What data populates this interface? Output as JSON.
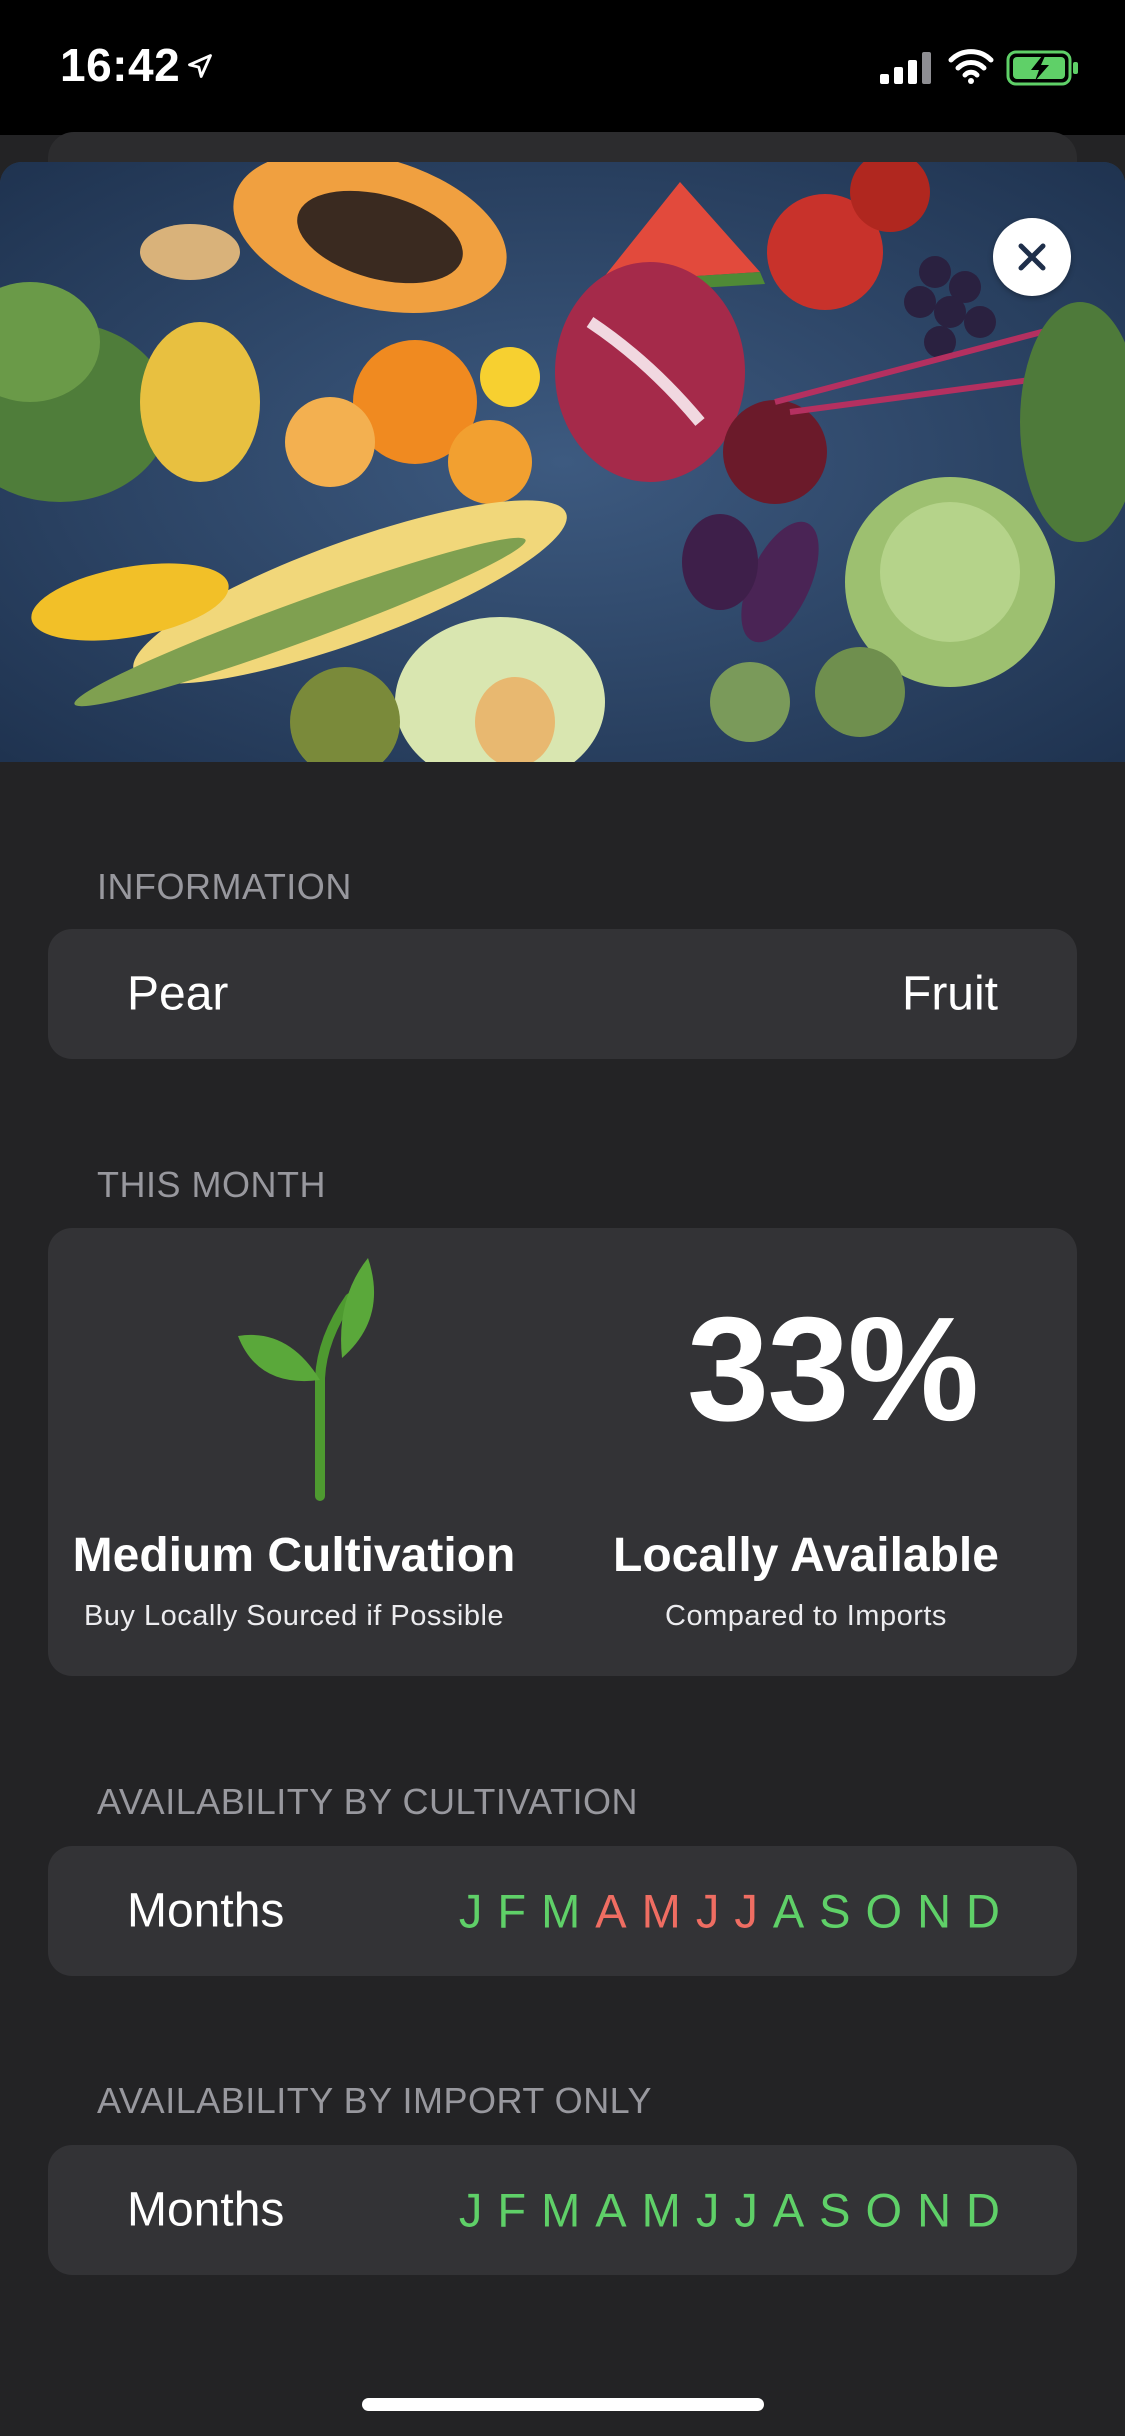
{
  "status_bar": {
    "time": "16:42",
    "icons": [
      "location-arrow-icon",
      "cellular-signal-icon",
      "wifi-icon",
      "battery-charging-icon"
    ]
  },
  "hero": {
    "image": "fresh fruit and vegetables photo",
    "close_icon": "close-icon"
  },
  "information": {
    "header": "INFORMATION",
    "name": "Pear",
    "category": "Fruit"
  },
  "this_month": {
    "header": "THIS MONTH",
    "icon": "sprout-icon",
    "cultivation_title": "Medium Cultivation",
    "cultivation_subtitle": "Buy Locally Sourced if Possible",
    "local_percent": "33%",
    "local_title": "Locally Available",
    "local_subtitle": "Compared to Imports"
  },
  "availability_cultivation": {
    "header": "AVAILABILITY BY CULTIVATION",
    "label": "Months",
    "months": [
      {
        "letter": "J",
        "color": "#5fd068"
      },
      {
        "letter": "F",
        "color": "#5fd068"
      },
      {
        "letter": "M",
        "color": "#5fd068"
      },
      {
        "letter": "A",
        "color": "#ef6d62"
      },
      {
        "letter": "M",
        "color": "#ef6d62"
      },
      {
        "letter": "J",
        "color": "#ef6d62"
      },
      {
        "letter": "J",
        "color": "#ef6d62"
      },
      {
        "letter": "A",
        "color": "#5fd068"
      },
      {
        "letter": "S",
        "color": "#5fd068"
      },
      {
        "letter": "O",
        "color": "#5fd068"
      },
      {
        "letter": "N",
        "color": "#5fd068"
      },
      {
        "letter": "D",
        "color": "#5fd068"
      }
    ]
  },
  "availability_import": {
    "header": "AVAILABILITY BY IMPORT ONLY",
    "label": "Months",
    "months": [
      {
        "letter": "J",
        "color": "#5fd068"
      },
      {
        "letter": "F",
        "color": "#5fd068"
      },
      {
        "letter": "M",
        "color": "#5fd068"
      },
      {
        "letter": "A",
        "color": "#5fd068"
      },
      {
        "letter": "M",
        "color": "#5fd068"
      },
      {
        "letter": "J",
        "color": "#5fd068"
      },
      {
        "letter": "J",
        "color": "#5fd068"
      },
      {
        "letter": "A",
        "color": "#5fd068"
      },
      {
        "letter": "S",
        "color": "#5fd068"
      },
      {
        "letter": "O",
        "color": "#5fd068"
      },
      {
        "letter": "N",
        "color": "#5fd068"
      },
      {
        "letter": "D",
        "color": "#5fd068"
      }
    ]
  },
  "colors": {
    "background": "#232325",
    "card": "#333336",
    "in_season": "#5fd068",
    "out_of_season": "#ef6d62",
    "sprout": "#5aa83a"
  }
}
